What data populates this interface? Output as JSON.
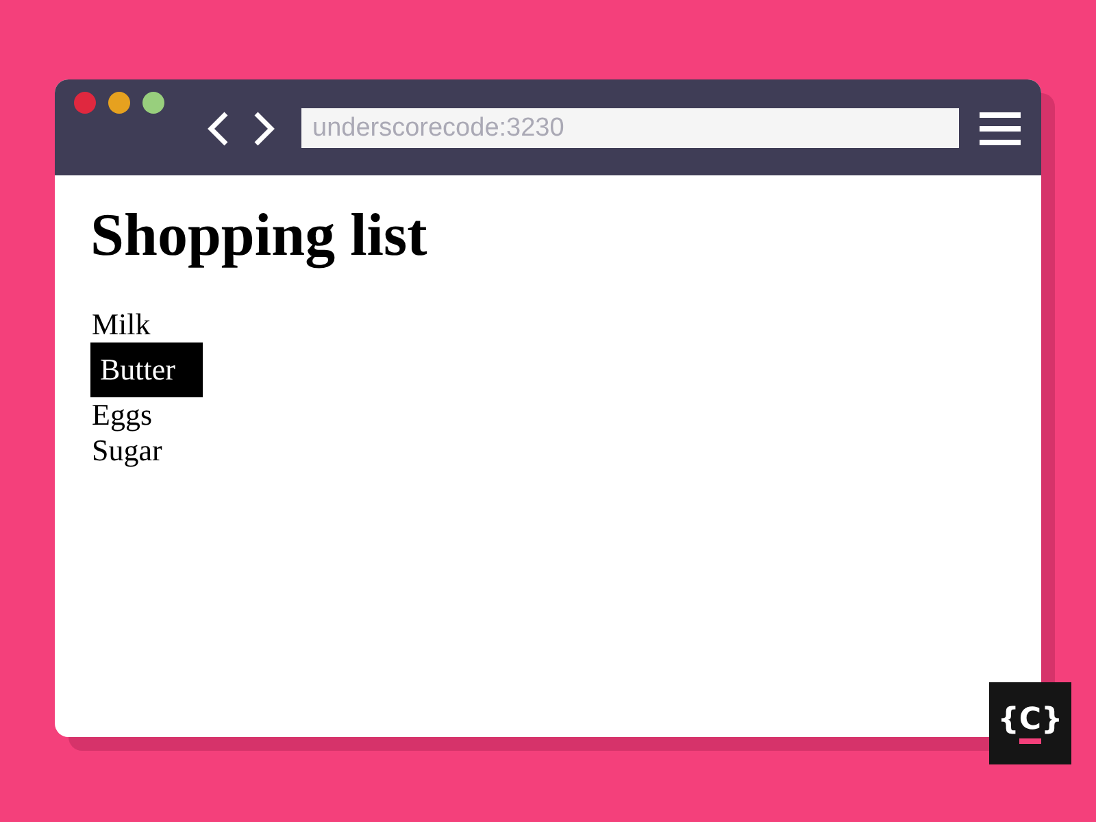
{
  "browser": {
    "address": "underscorecode:3230"
  },
  "page": {
    "heading": "Shopping list",
    "items": [
      {
        "label": "Milk",
        "selected": false
      },
      {
        "label": "Butter",
        "selected": true
      },
      {
        "label": "Eggs",
        "selected": false
      },
      {
        "label": "Sugar",
        "selected": false
      }
    ]
  },
  "logo": {
    "text": "{C}"
  }
}
